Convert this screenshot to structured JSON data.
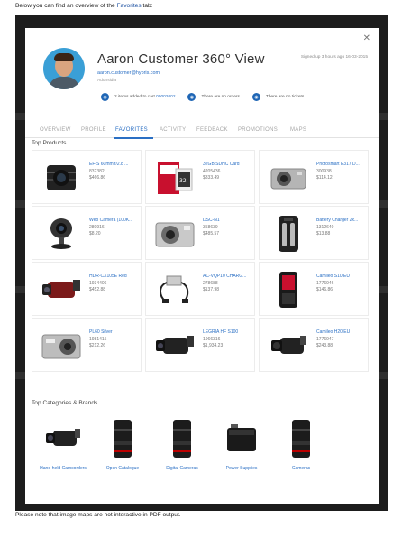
{
  "doc": {
    "intro_prefix": "Below you can find an overview of the ",
    "intro_link": "Favorites",
    "intro_suffix": " tab:",
    "outro": "Please note that image maps are not interactive in PDF output."
  },
  "customer": {
    "name": "Aaron Customer 360° View",
    "email": "aaron.customer@hybris.com",
    "subtitle": "Adunsidia",
    "signed_up": "Signed up 3 hours ago 16-03-2015",
    "close": "✕"
  },
  "info": {
    "cart_text": "2 items added to cart",
    "cart_link": "00002002",
    "orders": "There are no orders",
    "tickets": "There are no tickets"
  },
  "tabs": [
    "OVERVIEW",
    "PROFILE",
    "FAVORITES",
    "ACTIVITY",
    "FEEDBACK",
    "PROMOTIONS",
    "MAPS"
  ],
  "active_tab": "FAVORITES",
  "sections": {
    "top_products": "Top Products",
    "top_categories": "Top Categories & Brands"
  },
  "products": [
    {
      "name": "EF-S 60mm f/2.8 ...",
      "code": "832382",
      "price": "$466.86",
      "icon": "camera-lens-icon"
    },
    {
      "name": "32GB SDHC Card",
      "code": "4205436",
      "price": "$333.49",
      "icon": "sd-card-icon"
    },
    {
      "name": "Photosmart E317 D...",
      "code": "300938",
      "price": "$114.12",
      "icon": "compact-camera-icon"
    },
    {
      "name": "Web Camera (100K...",
      "code": "280916",
      "price": "$8.20",
      "icon": "webcam-icon"
    },
    {
      "name": "DSC-N1",
      "code": "358639",
      "price": "$485.57",
      "icon": "compact-camera-icon"
    },
    {
      "name": "Battery Charger 2x...",
      "code": "1312640",
      "price": "$13.88",
      "icon": "battery-charger-icon"
    },
    {
      "name": "HDR-CX105E Red",
      "code": "1934406",
      "price": "$452.88",
      "icon": "camcorder-icon"
    },
    {
      "name": "AC-VQP10 CHARG...",
      "code": "278688",
      "price": "$137.98",
      "icon": "charger-cable-icon"
    },
    {
      "name": "Camileo S10 EU",
      "code": "1776946",
      "price": "$146.86",
      "icon": "camileo-icon"
    },
    {
      "name": "PL60 Silver",
      "code": "1981415",
      "price": "$212.26",
      "icon": "compact-camera-icon"
    },
    {
      "name": "LEGRIA HF S100",
      "code": "1966316",
      "price": "$1,934.23",
      "icon": "camcorder-icon"
    },
    {
      "name": "Camileo H20 EU",
      "code": "1776947",
      "price": "$243.88",
      "icon": "camcorder-icon"
    }
  ],
  "categories": [
    {
      "label": "Hand-held Camcorders",
      "icon": "camcorder-icon"
    },
    {
      "label": "Open Catalogue",
      "icon": "camera-lens-icon"
    },
    {
      "label": "Digital Cameras",
      "icon": "camera-lens-icon"
    },
    {
      "label": "Power Supplies",
      "icon": "battery-icon"
    },
    {
      "label": "Cameras",
      "icon": "camera-lens-icon"
    }
  ],
  "colors": {
    "accent": "#2a6fc4",
    "icon_blue": "#1f66b5",
    "frame": "#1d1d1d"
  }
}
